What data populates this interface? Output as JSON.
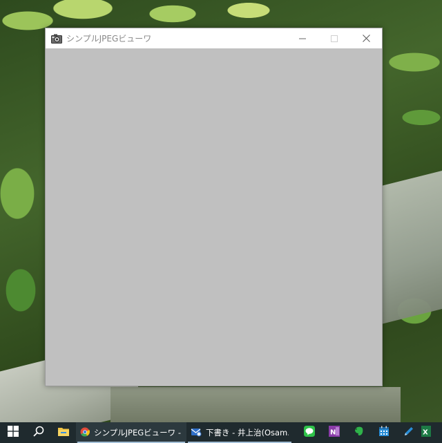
{
  "window": {
    "title": "シンプルJPEGビューワ",
    "controls": {
      "minimize_icon": "minimize-icon",
      "maximize_icon": "maximize-icon",
      "close_icon": "close-icon"
    },
    "client_background": "#c0c0c0"
  },
  "taskbar": {
    "start_icon": "windows-start-icon",
    "search_icon": "search-icon",
    "explorer_icon": "file-explorer-icon",
    "apps": [
      {
        "label": "シンプルJPEGビューワ - ...",
        "icon": "chrome-icon"
      },
      {
        "label": "下書き - 井上治(Osam...",
        "icon": "mail-icon"
      }
    ],
    "pinned": [
      {
        "icon": "line-icon",
        "color": "#2fc24a"
      },
      {
        "icon": "onenote-icon",
        "color": "#8a3ca8"
      },
      {
        "icon": "evernote-icon",
        "color": "#2fb34a"
      },
      {
        "icon": "calendar-icon",
        "color": "#2a8fd8"
      },
      {
        "icon": "pen-icon",
        "color": "#2a8fd8"
      },
      {
        "icon": "excel-icon",
        "color": "#1d7a45"
      }
    ]
  }
}
